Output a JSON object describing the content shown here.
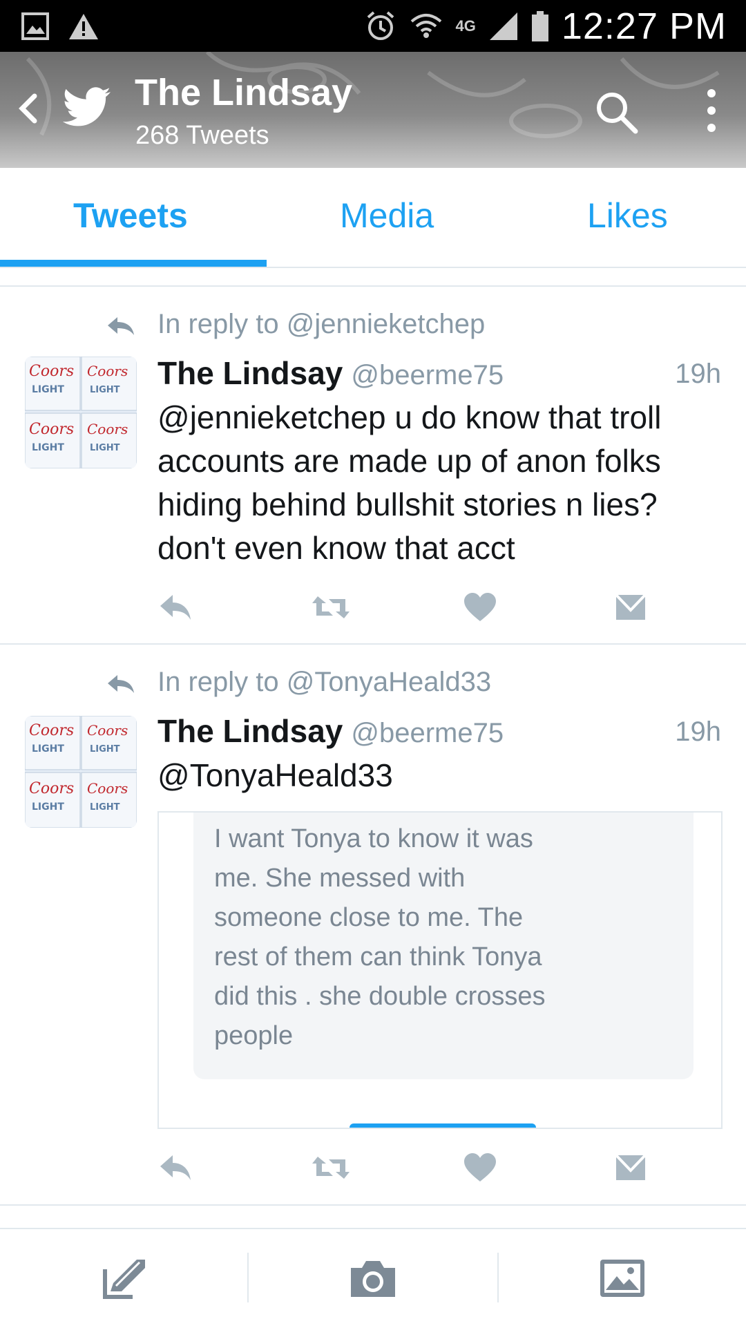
{
  "status_bar": {
    "network": "4G",
    "time": "12:27 PM",
    "icons": [
      "gallery-icon",
      "warning-icon",
      "alarm-icon",
      "wifi-icon",
      "signal-icon",
      "battery-icon"
    ]
  },
  "header": {
    "title": "The Lindsay",
    "subtitle": "268 Tweets",
    "icons": [
      "back-icon",
      "twitter-bird-icon",
      "search-icon",
      "more-vertical-icon"
    ]
  },
  "tabs": [
    {
      "label": "Tweets",
      "active": true
    },
    {
      "label": "Media",
      "active": false
    },
    {
      "label": "Likes",
      "active": false
    }
  ],
  "tweets": [
    {
      "reply_context": "In reply to @jennieketchep",
      "name": "The Lindsay",
      "handle": "@beerme75",
      "time": "19h",
      "text_lines": [
        "@jennieketchep u do know that troll",
        "accounts are made up of anon folks",
        "hiding behind bullshit stories n lies?",
        "don't even know that acct"
      ]
    },
    {
      "reply_context": "In reply to @TonyaHeald33",
      "name": "The Lindsay",
      "handle": "@beerme75",
      "time": "19h",
      "text_lines": [
        "@TonyaHeald33"
      ],
      "embed_lines": [
        "I want Tonya to know it was",
        "me. She messed with",
        "someone close to me. The",
        "rest of them can think Tonya",
        "did this . she double crosses",
        "people"
      ]
    }
  ],
  "colors": {
    "accent": "#1da1f2",
    "muted": "#8899a6",
    "divider": "#e1e8ed"
  },
  "bottom_bar": {
    "icons": [
      "compose-icon",
      "camera-icon",
      "image-icon"
    ]
  }
}
